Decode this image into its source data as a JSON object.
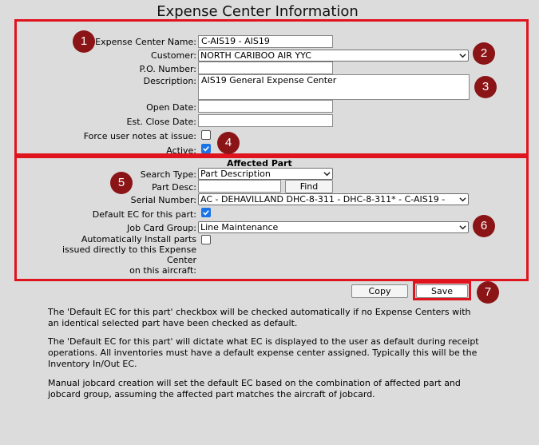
{
  "page_title": "Expense Center Information",
  "form": {
    "ec_name_label": "Expense Center Name:",
    "ec_name_value": "C-AIS19 - AIS19",
    "customer_label": "Customer:",
    "customer_value": "NORTH CARIBOO AIR YYC",
    "po_label": "P.O. Number:",
    "po_value": "",
    "description_label": "Description:",
    "description_value": "AIS19 General Expense Center",
    "open_date_label": "Open Date:",
    "open_date_value": "",
    "est_close_label": "Est. Close Date:",
    "est_close_value": "",
    "force_notes_label": "Force user notes at issue:",
    "force_notes_checked": false,
    "active_label": "Active:",
    "active_checked": true
  },
  "affected_part": {
    "heading": "Affected Part",
    "search_type_label": "Search Type:",
    "search_type_value": "Part Description",
    "part_desc_label": "Part Desc:",
    "part_desc_value": "",
    "find_button": "Find",
    "serial_label": "Serial Number:",
    "serial_value": "AC - DEHAVILLAND DHC-8-311 - DHC-8-311* - C-AIS19 -",
    "default_ec_label": "Default EC for this part:",
    "default_ec_checked": true,
    "job_card_label": "Job Card Group:",
    "job_card_value": "Line Maintenance",
    "auto_install_label_1": "Automatically Install parts",
    "auto_install_label_2": "issued directly to this Expense",
    "auto_install_label_3": "Center",
    "auto_install_label_4": "on this aircraft:",
    "auto_install_checked": false
  },
  "actions": {
    "copy_button": "Copy",
    "save_button": "Save"
  },
  "markers": [
    "1",
    "2",
    "3",
    "4",
    "5",
    "6",
    "7"
  ],
  "notes": [
    "The 'Default EC for this part' checkbox will be checked automatically if no Expense Centers with an identical selected part have been checked as default.",
    "The 'Default EC for this part' will dictate what EC is displayed to the user as default during receipt operations. All inventories must have a default expense center assigned. Typically this will be the Inventory In/Out EC.",
    "Manual jobcard creation will set the default EC based on the combination of affected part and jobcard group, assuming the affected part matches the aircraft of jobcard."
  ],
  "colors": {
    "highlight": "#e0141e",
    "marker": "#8b1416",
    "checkbox": "#1a73e8",
    "background": "#dcdcdc"
  }
}
